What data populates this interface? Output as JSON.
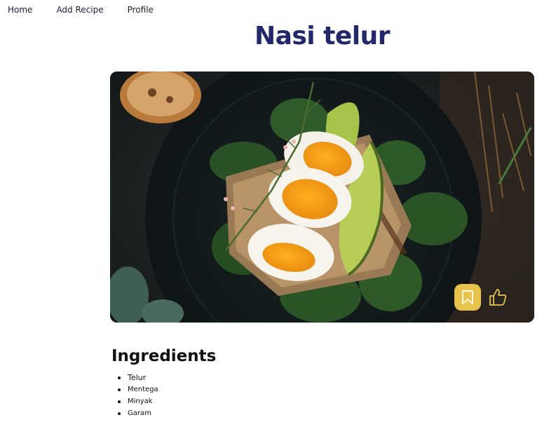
{
  "nav": {
    "items": [
      {
        "label": "Home"
      },
      {
        "label": "Add Recipe"
      },
      {
        "label": "Profile"
      }
    ]
  },
  "recipe": {
    "title": "Nasi telur",
    "image_subject": "egg-avocado-toast-photo"
  },
  "actions": {
    "bookmark_icon": "bookmark-icon",
    "like_icon": "thumbs-up-icon",
    "accent_color": "#e7c34c"
  },
  "ingredients": {
    "heading": "Ingredients",
    "items": [
      "Telur",
      "Mentega",
      "Minyak",
      "Garam"
    ]
  },
  "colors": {
    "title": "#23286b",
    "nav_text": "#1b1f3b",
    "accent": "#e7c34c"
  }
}
